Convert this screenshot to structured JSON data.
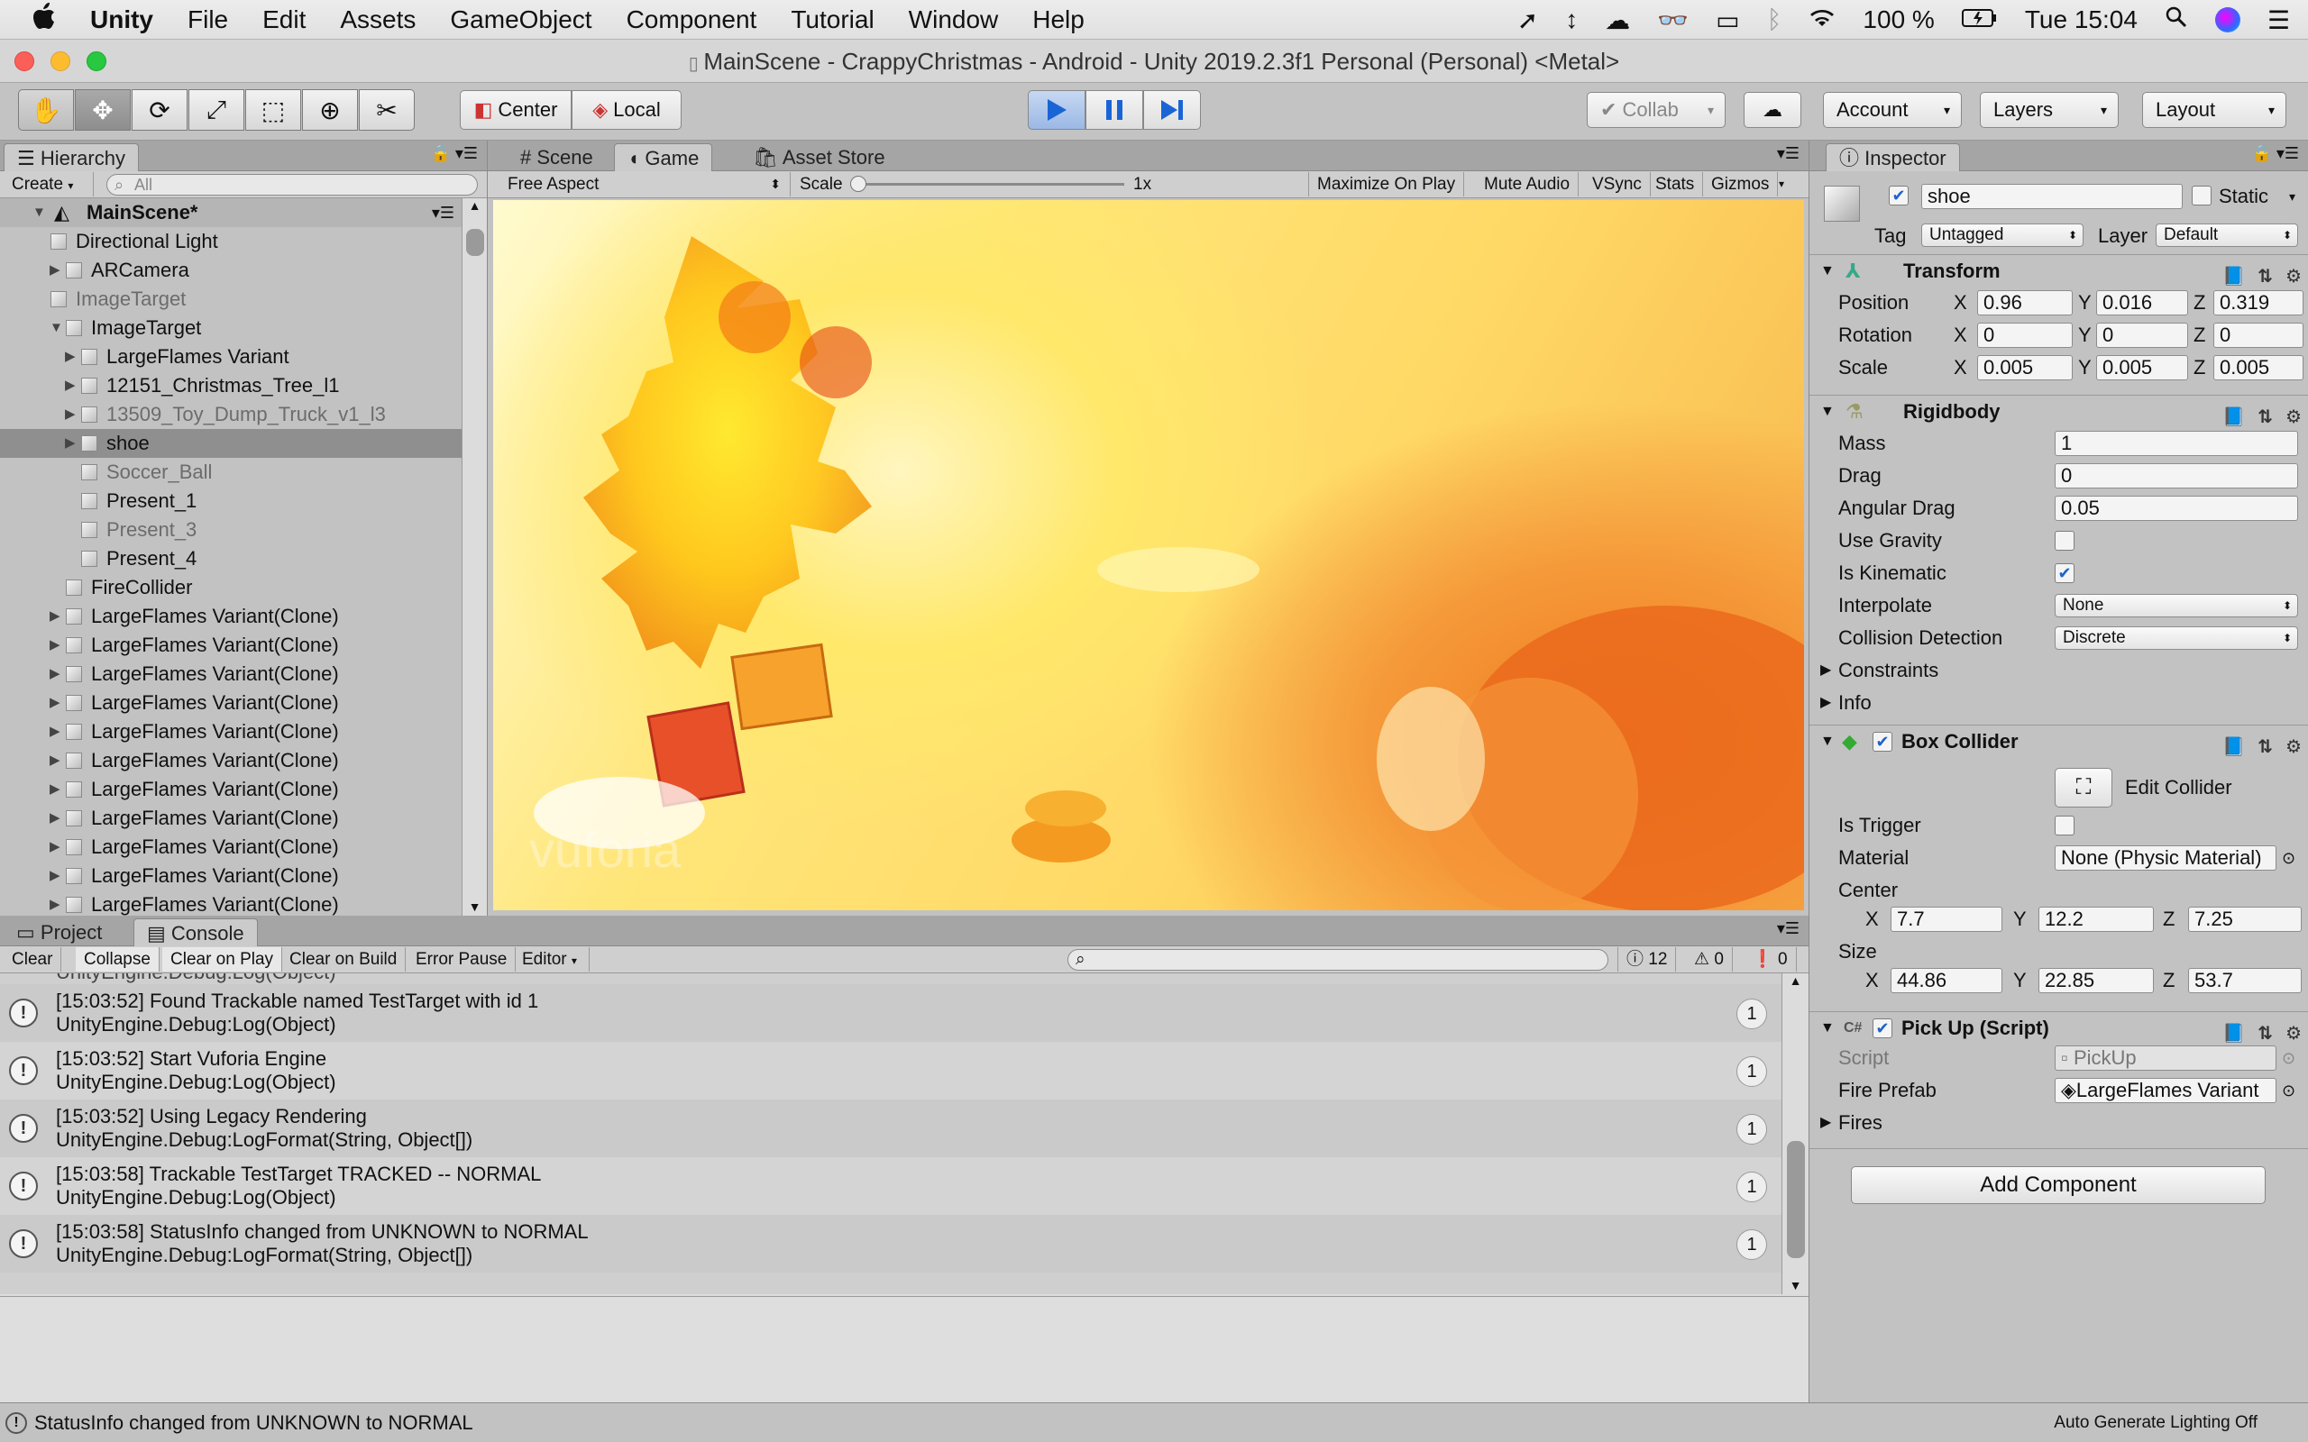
{
  "menubar": {
    "apple": "",
    "app": "Unity",
    "items": [
      "File",
      "Edit",
      "Assets",
      "GameObject",
      "Component",
      "Tutorial",
      "Window",
      "Help"
    ],
    "battery": "100 %",
    "clock": "Tue 15:04"
  },
  "window": {
    "title": "MainScene - CrappyChristmas - Android - Unity 2019.2.3f1 Personal (Personal) <Metal>"
  },
  "toolbar": {
    "pivot": "Center",
    "space": "Local",
    "collab": "Collab",
    "account": "Account",
    "layers": "Layers",
    "layout": "Layout"
  },
  "hierarchy": {
    "tab": "Hierarchy",
    "create": "Create",
    "search_placeholder": "All",
    "scene": "MainScene*",
    "items": [
      {
        "label": "Directional Light"
      },
      {
        "label": "ARCamera"
      },
      {
        "label": "ImageTarget"
      },
      {
        "label": "ImageTarget"
      },
      {
        "label": "LargeFlames Variant"
      },
      {
        "label": "12151_Christmas_Tree_l1"
      },
      {
        "label": "13509_Toy_Dump_Truck_v1_l3"
      },
      {
        "label": "shoe"
      },
      {
        "label": "Soccer_Ball"
      },
      {
        "label": "Present_1"
      },
      {
        "label": "Present_3"
      },
      {
        "label": "Present_4"
      },
      {
        "label": "FireCollider"
      },
      {
        "label": "LargeFlames Variant(Clone)"
      },
      {
        "label": "LargeFlames Variant(Clone)"
      },
      {
        "label": "LargeFlames Variant(Clone)"
      },
      {
        "label": "LargeFlames Variant(Clone)"
      },
      {
        "label": "LargeFlames Variant(Clone)"
      },
      {
        "label": "LargeFlames Variant(Clone)"
      },
      {
        "label": "LargeFlames Variant(Clone)"
      },
      {
        "label": "LargeFlames Variant(Clone)"
      },
      {
        "label": "LargeFlames Variant(Clone)"
      },
      {
        "label": "LargeFlames Variant(Clone)"
      },
      {
        "label": "LargeFlames Variant(Clone)"
      }
    ]
  },
  "game": {
    "tabs": [
      "Scene",
      "Game",
      "Asset Store"
    ],
    "aspect": "Free Aspect",
    "scale_label": "Scale",
    "scale_value": "1x",
    "maximize": "Maximize On Play",
    "mute": "Mute Audio",
    "vsync": "VSync",
    "stats": "Stats",
    "gizmos": "Gizmos",
    "watermark": "vuforia"
  },
  "inspector": {
    "tab": "Inspector",
    "object_name": "shoe",
    "static_label": "Static",
    "tag_label": "Tag",
    "tag_value": "Untagged",
    "layer_label": "Layer",
    "layer_value": "Default",
    "transform": {
      "title": "Transform",
      "position": {
        "label": "Position",
        "x": "0.96",
        "y": "0.016",
        "z": "0.319"
      },
      "rotation": {
        "label": "Rotation",
        "x": "0",
        "y": "0",
        "z": "0"
      },
      "scale": {
        "label": "Scale",
        "x": "0.005",
        "y": "0.005",
        "z": "0.005"
      }
    },
    "rigidbody": {
      "title": "Rigidbody",
      "mass_label": "Mass",
      "mass": "1",
      "drag_label": "Drag",
      "drag": "0",
      "angular_label": "Angular Drag",
      "angular": "0.05",
      "gravity_label": "Use Gravity",
      "kinematic_label": "Is Kinematic",
      "interpolate_label": "Interpolate",
      "interpolate": "None",
      "collision_label": "Collision Detection",
      "collision": "Discrete",
      "constraints": "Constraints",
      "info": "Info"
    },
    "box_collider": {
      "title": "Box Collider",
      "edit": "Edit Collider",
      "trigger_label": "Is Trigger",
      "material_label": "Material",
      "material": "None (Physic Material)",
      "center_label": "Center",
      "cx": "7.7",
      "cy": "12.2",
      "cz": "7.25",
      "size_label": "Size",
      "sx": "44.86",
      "sy": "22.85",
      "sz": "53.7"
    },
    "pickup": {
      "title": "Pick Up (Script)",
      "script_label": "Script",
      "script": "PickUp",
      "prefab_label": "Fire Prefab",
      "prefab": "LargeFlames Variant",
      "fires": "Fires"
    },
    "add_component": "Add Component"
  },
  "console": {
    "tabs": [
      "Project",
      "Console"
    ],
    "buttons": [
      "Clear",
      "Collapse",
      "Clear on Play",
      "Clear on Build",
      "Error Pause",
      "Editor"
    ],
    "count_log": "12",
    "count_warn": "0",
    "count_err": "0",
    "partial": "UnityEngine.Debug:Log(Object)",
    "entries": [
      {
        "line1": "[15:03:52] Found Trackable named TestTarget with id 1",
        "line2": "UnityEngine.Debug:Log(Object)",
        "count": "1"
      },
      {
        "line1": "[15:03:52] Start Vuforia Engine",
        "line2": "UnityEngine.Debug:Log(Object)",
        "count": "1"
      },
      {
        "line1": "[15:03:52] Using Legacy Rendering",
        "line2": "UnityEngine.Debug:LogFormat(String, Object[])",
        "count": "1"
      },
      {
        "line1": "[15:03:58] Trackable TestTarget TRACKED -- NORMAL",
        "line2": "UnityEngine.Debug:Log(Object)",
        "count": "1"
      },
      {
        "line1": "[15:03:58] StatusInfo changed from UNKNOWN to NORMAL",
        "line2": "UnityEngine.Debug:LogFormat(String, Object[])",
        "count": "1"
      }
    ]
  },
  "status": {
    "message": "StatusInfo changed from UNKNOWN to NORMAL",
    "lighting": "Auto Generate Lighting Off"
  }
}
